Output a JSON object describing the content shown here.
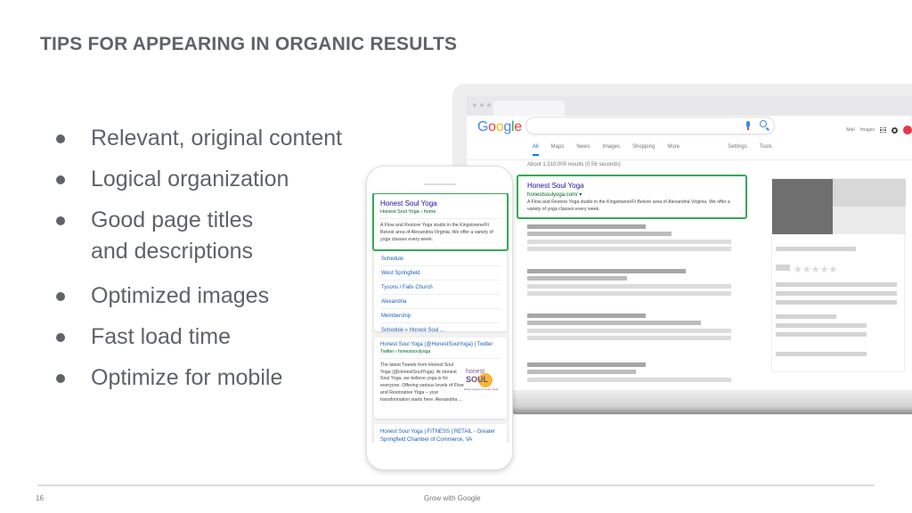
{
  "slide": {
    "title": "TIPS FOR APPEARING IN ORGANIC RESULTS",
    "bullets": [
      "Relevant, original content",
      "Logical organization",
      "Good page titles\nand descriptions",
      "Optimized images",
      "Fast load time",
      "Optimize for mobile"
    ],
    "bullet_lines": {
      "b2_line1": "Good page titles",
      "b2_line2": "and descriptions"
    },
    "page_number": "16",
    "footer_brand": "Grow with Google"
  },
  "desktop": {
    "logo": [
      "G",
      "o",
      "o",
      "g",
      "l",
      "e"
    ],
    "logo_colors": [
      "#4285f4",
      "#ea4335",
      "#fbbc05",
      "#4285f4",
      "#34a853",
      "#ea4335"
    ],
    "top_links": [
      "Mail",
      "Images"
    ],
    "nav_tabs": [
      "All",
      "Maps",
      "News",
      "Images",
      "Shopping",
      "More",
      "Settings",
      "Tools"
    ],
    "active_tab": "All",
    "result_stats": "About 1,510,000 results (0.56 seconds)",
    "highlighted_result": {
      "title": "Honest Soul Yoga",
      "url": "honestsoulyoga.com/ ▾",
      "description": "A Flow and Restore Yoga studio in the Kingstowne/Ft Belvoir area of Alexandria Virginia. We offer a variety of yoga classes every week."
    },
    "knowledge_panel_stars": "★★★★★"
  },
  "mobile": {
    "highlighted_result": {
      "title": "Honest Soul Yoga",
      "breadcrumb": "Honest Soul Yoga › home",
      "description": "A Flow and Restore Yoga studio in the Kingstowne/Ft Belvoir area of Alexandria Virginia. We offer a variety of yoga classes every week."
    },
    "sitelinks": [
      "Schedule",
      "West Springfield",
      "Tysons / Falls Church",
      "Alexandria",
      "Membership",
      "Schedule » Honest Soul ..."
    ],
    "twitter_result": {
      "title": "Honest Soul Yoga (@HonestSoulYoga) | Twitter",
      "url": "Twitter › honestsoulyoga",
      "description": "The latest Tweets from Honest Soul Yoga (@HonestSoulYoga). At Honest Soul Yoga, we believe yoga is for everyone. Offering various levels of Flow and Restorative Yoga – your transformation starts here. Alexandria ..."
    },
    "logo_text": {
      "line1": "honest",
      "line2": "SOUL",
      "tagline": "where yoga is for every body"
    },
    "chamber_result": {
      "title": "Honest Soul Yoga | FITNESS | RETAIL - Greater Springfield Chamber of Commerce, VA"
    }
  },
  "colors": {
    "highlight_border": "#34a853",
    "link": "#1a0dab",
    "url_green": "#006621",
    "text_gray": "#5f6368"
  }
}
